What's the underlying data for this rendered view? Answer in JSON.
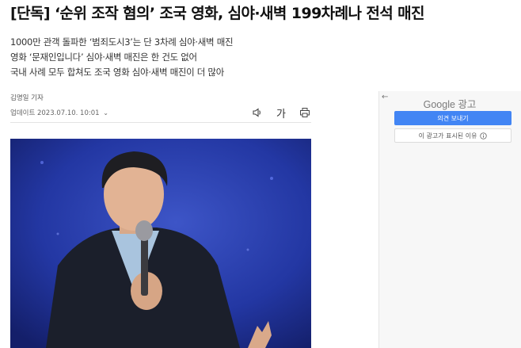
{
  "article": {
    "headline": "[단독] ‘순위 조작 혐의’ 조국 영화, 심야·새벽 199차례나 전석 매진",
    "subheadlines": [
      "1000만 관객 돌파한 ‘범죄도시3’는 단 3차례 심야·새벽 매진",
      "영화 ‘문재인입니다’ 심야·새벽 매진은 한 건도 없어",
      "국내 사례 모두 합쳐도 조국 영화 심야·새벽 매진이 더 많아"
    ],
    "byline": "김명일 기자",
    "updated": "업데이트 2023.07.10. 10:01",
    "font_size_label": "가"
  },
  "ad": {
    "title": "Google 광고",
    "feedback_button": "의견 보내기",
    "why_button": "이 광고가 표시된 이유",
    "button_color": "#4285f4"
  },
  "icons": {
    "audio": "speaker-icon",
    "font": "font-size-icon",
    "print": "print-icon",
    "back": "back-arrow-icon",
    "info": "info-icon"
  }
}
